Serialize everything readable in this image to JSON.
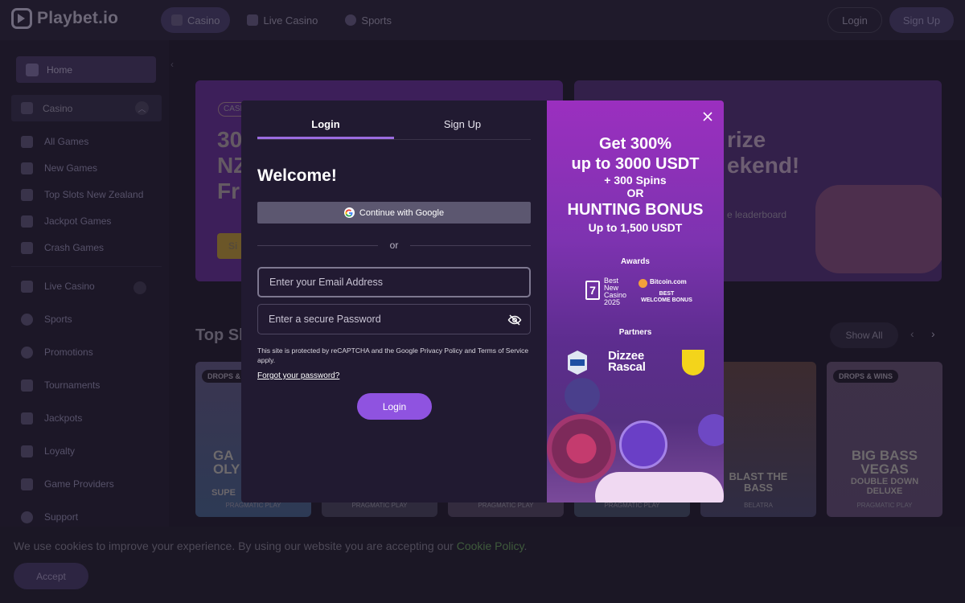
{
  "app": {
    "logo_text": "Playbet.io"
  },
  "topnav": {
    "tabs": [
      {
        "label": "Casino",
        "icon": "casino-icon"
      },
      {
        "label": "Live Casino",
        "icon": "live-casino-icon"
      },
      {
        "label": "Sports",
        "icon": "sports-icon"
      }
    ],
    "login_label": "Login",
    "signup_label": "Sign Up"
  },
  "sidebar": {
    "home_label": "Home",
    "casino_label": "Casino",
    "casino_items": [
      {
        "label": "All Games",
        "icon": "grid-icon"
      },
      {
        "label": "New Games",
        "icon": "bolt-icon"
      },
      {
        "label": "Top Slots New Zealand",
        "icon": "slots-icon"
      },
      {
        "label": "Jackpot Games",
        "icon": "jackpot-icon"
      },
      {
        "label": "Crash Games",
        "icon": "plane-icon"
      }
    ],
    "items": [
      {
        "label": "Live Casino",
        "icon": "live-casino-icon"
      },
      {
        "label": "Sports",
        "icon": "sports-icon"
      },
      {
        "label": "Promotions",
        "icon": "promotions-icon"
      },
      {
        "label": "Tournaments",
        "icon": "trophy-icon"
      },
      {
        "label": "Jackpots",
        "icon": "jackpot-icon"
      },
      {
        "label": "Loyalty",
        "icon": "loyalty-icon"
      },
      {
        "label": "Game Providers",
        "icon": "providers-icon"
      },
      {
        "label": "Support",
        "icon": "support-icon"
      }
    ]
  },
  "main": {
    "banner1": {
      "tag": "CASI",
      "lines": [
        "30",
        "NZ",
        "Fr"
      ],
      "button": "Si"
    },
    "banner2": {
      "lines": [
        "rize",
        "ekend!"
      ],
      "subtitle": "e leaderboard"
    },
    "section_title": "Top Sl",
    "show_all_label": "Show All",
    "games": [
      {
        "badge": "DROPS & WINS",
        "title": "GA\nOLY",
        "subtitle": "SUPE",
        "provider": "PRAGMATIC PLAY"
      },
      {
        "badge": "",
        "title": "",
        "subtitle": "",
        "provider": "PRAGMATIC PLAY"
      },
      {
        "badge": "",
        "title": "",
        "subtitle": "",
        "provider": "PRAGMATIC PLAY"
      },
      {
        "badge": "",
        "title": "",
        "subtitle": "",
        "provider": "PRAGMATIC PLAY"
      },
      {
        "badge": "",
        "title": "BLAST THE\nBASS",
        "subtitle": "",
        "provider": "BELATRA"
      },
      {
        "badge": "DROPS & WINS",
        "title": "BIG BASS\nVEGAS",
        "subtitle": "DOUBLE DOWN\nDELUXE",
        "provider": "PRAGMATIC PLAY"
      }
    ]
  },
  "cookie": {
    "text": "We use cookies to improve your experience. By using our website you are accepting our ",
    "link": "Cookie Policy",
    "suffix": ".",
    "accept_label": "Accept"
  },
  "modal": {
    "tabs": [
      "Login",
      "Sign Up"
    ],
    "welcome": "Welcome!",
    "google_label": "Continue with Google",
    "or_label": "or",
    "email_placeholder": "Enter your Email Address",
    "password_placeholder": "Enter a secure Password",
    "recaptcha_text": "This site is protected by reCAPTCHA and the Google Privacy Policy and Terms of Service apply.",
    "forgot_label": "Forgot your password?",
    "login_label": "Login",
    "promo": {
      "line1": "Get 300%",
      "line2": "up to 3000 USDT",
      "line3": "+ 300 Spins",
      "line4": "OR",
      "line5": "HUNTING BONUS",
      "line6": "Up to 1,500 USDT",
      "awards_heading": "Awards",
      "award1_number": "7",
      "award1_text": "Best\nNew\nCasino\n2025",
      "award2_title": "Bitcoin.com",
      "award2_text": "BEST\nWELCOME BONUS",
      "partners_heading": "Partners",
      "partner2_text": "Dizzee\nRascal"
    }
  },
  "colors": {
    "accent": "#8f53e0",
    "promo_top": "#9b2fbf",
    "google_btn": "#5c5770"
  }
}
